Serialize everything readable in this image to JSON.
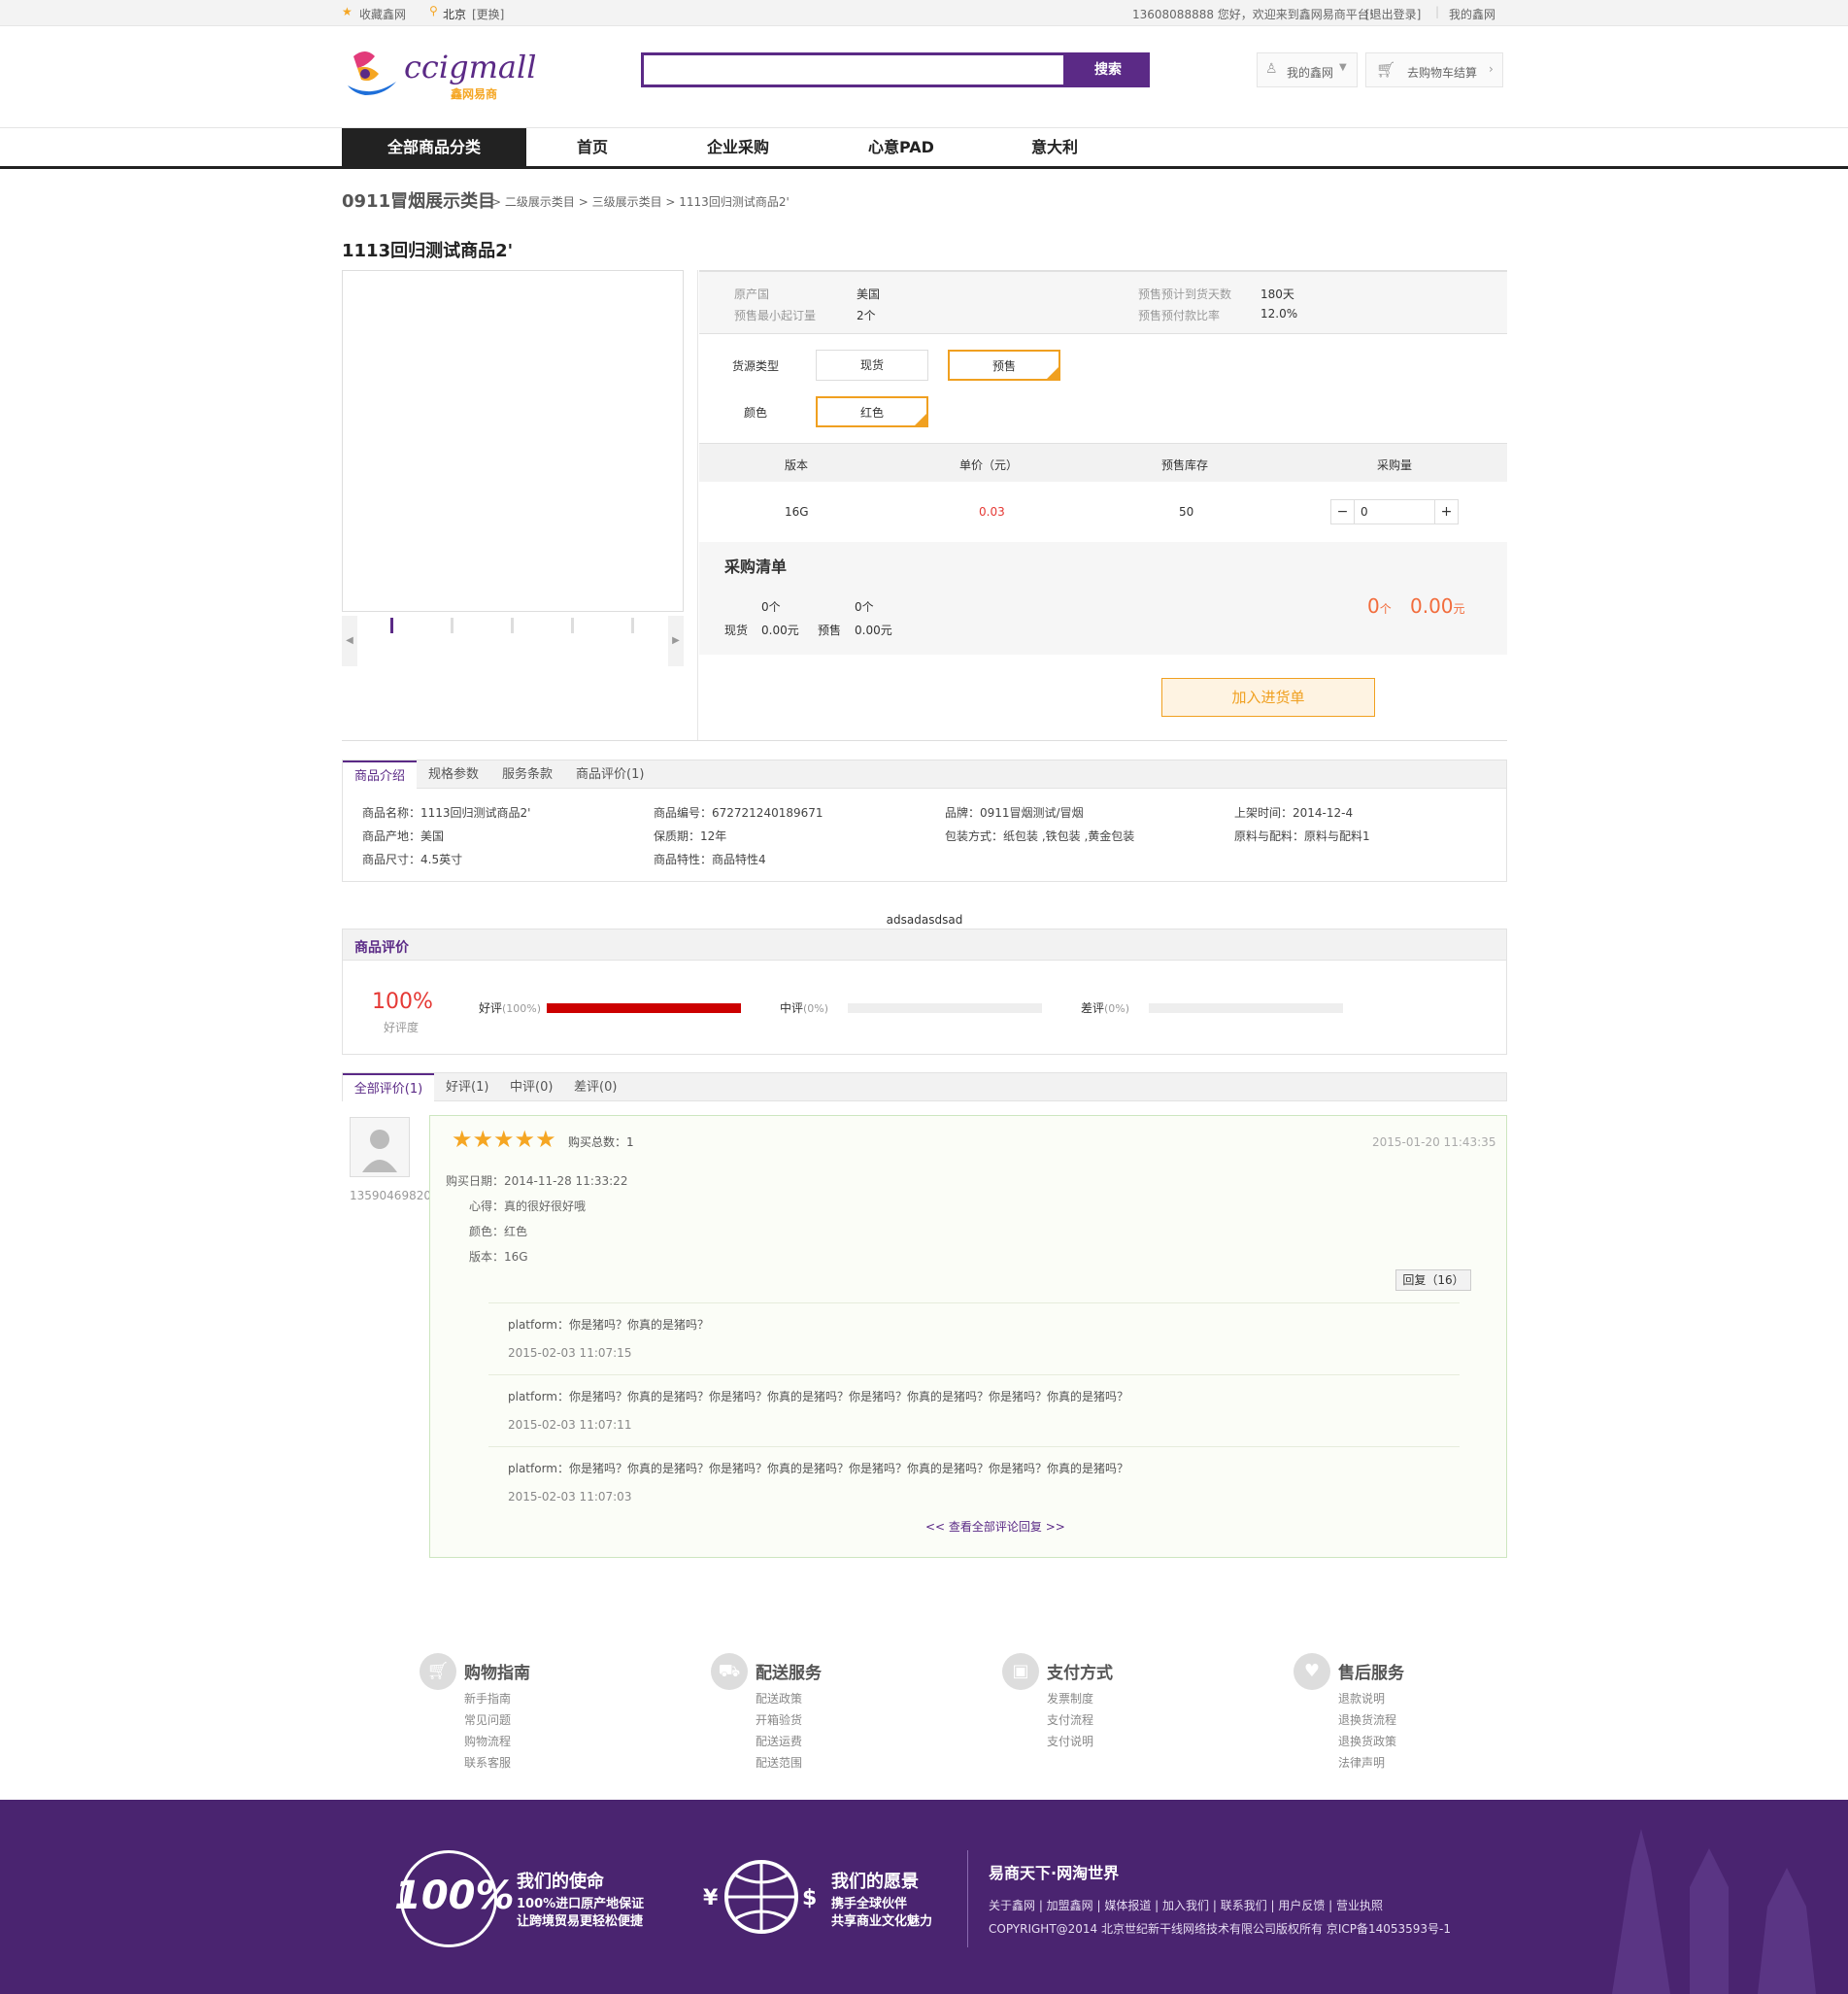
{
  "topbar": {
    "favorite": "收藏鑫网",
    "location": "北京",
    "change": "[更换]",
    "welcome": "13608088888 您好，欢迎来到鑫网易商平台!",
    "logout": "[退出登录]",
    "my_account": "我的鑫网"
  },
  "header": {
    "logo_text": "ccigmall",
    "logo_sub": "鑫网易商",
    "search_placeholder": "",
    "search_button": "搜索",
    "my_xinwang": "我的鑫网",
    "cart": "去购物车结算"
  },
  "nav": {
    "all_categories": "全部商品分类",
    "items": [
      "首页",
      "企业采购",
      "心意PAD",
      "意大利"
    ]
  },
  "breadcrumb": {
    "root": "0911冒烟展示类目",
    "level2": "二级展示类目",
    "level3": "三级展示类目",
    "current": "1113回归测试商品2'"
  },
  "product": {
    "title": "1113回归测试商品2'",
    "origin_label": "原产国",
    "origin_value": "美国",
    "min_order_label": "预售最小起订量",
    "min_order_value": "2个",
    "arrival_label": "预售预计到货天数",
    "arrival_value": "180天",
    "payment_label": "预售预付款比率",
    "payment_value": "12.0%",
    "source_label": "货源类型",
    "source_options": [
      "现货",
      "预售"
    ],
    "color_label": "颜色",
    "color_options": [
      "红色"
    ],
    "table_headers": [
      "版本",
      "单价（元）",
      "预售库存",
      "采购量"
    ],
    "row": {
      "version": "16G",
      "price": "0.03",
      "stock": "50",
      "qty": "0"
    },
    "purchase_list_title": "采购清单",
    "spot_count": "0个",
    "spot_label": "现货",
    "spot_amount": "0.00元",
    "presale_count": "0个",
    "presale_label": "预售",
    "presale_amount": "0.00元",
    "total_count": "0",
    "total_count_unit": "个",
    "total_amount": "0.00",
    "total_amount_unit": "元",
    "add_button": "加入进货单"
  },
  "detail_tabs": [
    "商品介绍",
    "规格参数",
    "服务条款",
    "商品评价(1)"
  ],
  "detail_info": [
    [
      "商品名称：1113回归测试商品2'",
      "商品编号：672721240189671",
      "品牌：0911冒烟测试/冒烟",
      "上架时间：2014-12-4"
    ],
    [
      "商品产地：美国",
      "保质期：12年",
      "包装方式：纸包装 ,铁包装 ,黄金包装",
      "原料与配料：原料与配料1"
    ],
    [
      "商品尺寸：4.5英寸",
      "商品特性：商品特性4"
    ]
  ],
  "description_text": "adsadasdsad",
  "rating": {
    "title": "商品评价",
    "score": "100%",
    "score_label": "好评度",
    "good_label": "好评",
    "good_pct": "(100%)",
    "good_value": 100,
    "mid_label": "中评",
    "mid_pct": "(0%)",
    "mid_value": 0,
    "bad_label": "差评",
    "bad_pct": "(0%)",
    "bad_value": 0
  },
  "review_tabs": [
    "全部评价(1)",
    "好评(1)",
    "中评(0)",
    "差评(0)"
  ],
  "review": {
    "user": "13590469820",
    "stars": 5,
    "buy_total": "购买总数：1",
    "date": "2015-01-20 11:43:35",
    "buy_date": "购买日期：2014-11-28 11:33:22",
    "comment": "心得：真的很好很好哦",
    "color": "颜色：红色",
    "version": "版本：16G",
    "reply_button": "回复（16）",
    "replies": [
      {
        "text": "platform：你是猪吗？你真的是猪吗？",
        "date": "2015-02-03 11:07:15"
      },
      {
        "text": "platform：你是猪吗？你真的是猪吗？你是猪吗？你真的是猪吗？你是猪吗？你真的是猪吗？你是猪吗？你真的是猪吗？",
        "date": "2015-02-03 11:07:11"
      },
      {
        "text": "platform：你是猪吗？你真的是猪吗？你是猪吗？你真的是猪吗？你是猪吗？你真的是猪吗？你是猪吗？你真的是猪吗？",
        "date": "2015-02-03 11:07:03"
      }
    ],
    "view_all": "<< 查看全部评论回复 >>"
  },
  "footer_links": [
    {
      "title": "购物指南",
      "icon": "cart-icon",
      "links": [
        "新手指南",
        "常见问题",
        "购物流程",
        "联系客服"
      ]
    },
    {
      "title": "配送服务",
      "icon": "truck-icon",
      "links": [
        "配送政策",
        "开箱验货",
        "配送运费",
        "配送范围"
      ]
    },
    {
      "title": "支付方式",
      "icon": "wallet-icon",
      "links": [
        "发票制度",
        "支付流程",
        "支付说明"
      ]
    },
    {
      "title": "售后服务",
      "icon": "heart-icon",
      "links": [
        "退款说明",
        "退换货流程",
        "退换货政策",
        "法律声明"
      ]
    }
  ],
  "footer_bottom": {
    "mission_badge": "100%",
    "mission_title": "我们的使命",
    "mission_line1": "100%进口原产地保证",
    "mission_line2": "让跨境贸易更轻松便捷",
    "vision_title": "我们的愿景",
    "vision_line1": "携手全球伙伴",
    "vision_line2": "共享商业文化魅力",
    "slogan": "易商天下·网淘世界",
    "links": "关于鑫网 | 加盟鑫网 | 媒体报道 | 加入我们 | 联系我们 | 用户反馈 | 营业执照",
    "copyright": "COPYRIGHT@2014 北京世纪新干线网络技术有限公司版权所有 京ICP备14053593号-1"
  },
  "colors": {
    "brand_purple": "#5b2a86",
    "accent_orange": "#f0a020",
    "price_red": "#e53935",
    "footer_bg": "#4a2470"
  }
}
